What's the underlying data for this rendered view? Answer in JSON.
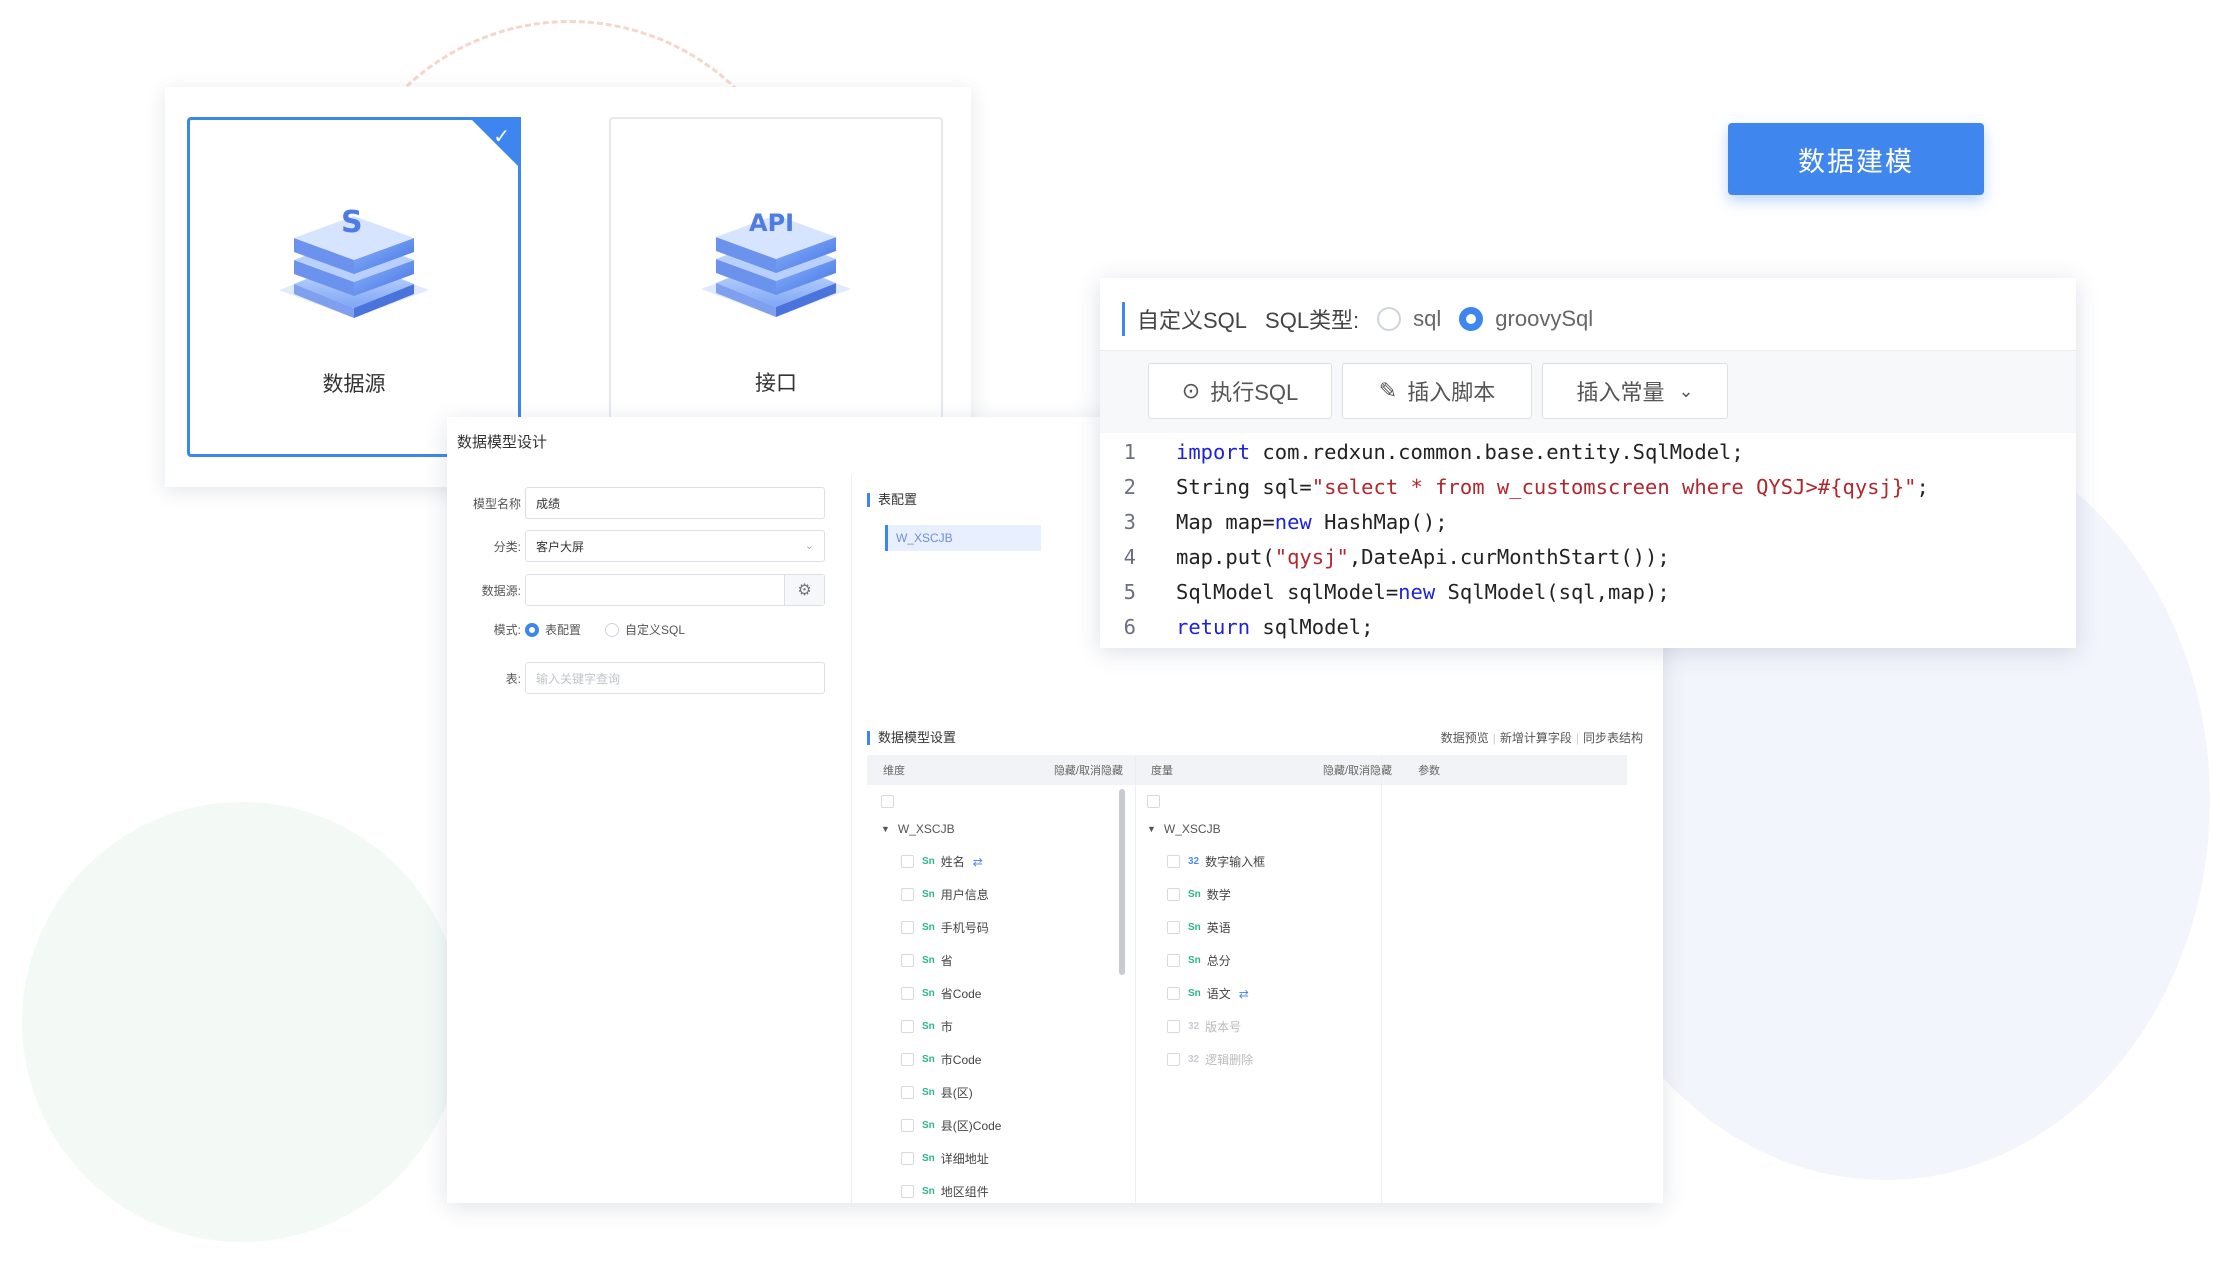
{
  "source_cards": [
    {
      "label": "数据源",
      "selected": true,
      "icon": "database-sql-icon"
    },
    {
      "label": "接口",
      "selected": false,
      "icon": "database-api-icon"
    }
  ],
  "model_button": {
    "label": "数据建模"
  },
  "designer": {
    "title": "数据模型设计",
    "form": {
      "name_label": "模型名称",
      "name_value": "成绩",
      "category_label": "分类:",
      "category_value": "客户大屏",
      "source_label": "数据源:",
      "source_value": "",
      "mode_label": "模式:",
      "mode_options": [
        "表配置",
        "自定义SQL"
      ],
      "table_label": "表:",
      "table_placeholder": "输入关键字查询"
    },
    "table_config": {
      "title": "表配置",
      "selected_table": "W_XSCJB"
    },
    "settings": {
      "title": "数据模型设置",
      "links": [
        "数据预览",
        "新增计算字段",
        "同步表结构"
      ],
      "dim_header": "维度",
      "dim_hide": "隐藏/取消隐藏",
      "measure_header": "度量",
      "measure_hide": "隐藏/取消隐藏",
      "param_header": "参数",
      "dim_root": "W_XSCJB",
      "dim_fields": [
        "姓名",
        "用户信息",
        "手机号码",
        "省",
        "省Code",
        "市",
        "市Code",
        "县(区)",
        "县(区)Code",
        "详细地址",
        "地区组件"
      ],
      "measure_root": "W_XSCJB",
      "measure_fields": [
        "数字输入框",
        "数学",
        "英语",
        "总分",
        "语文",
        "版本号",
        "逻辑删除"
      ]
    }
  },
  "sql_editor": {
    "title": "自定义SQL",
    "type_label": "SQL类型:",
    "type_options": [
      "sql",
      "groovySql"
    ],
    "selected_type": "groovySql",
    "toolbar": {
      "run": "执行SQL",
      "insert_script": "插入脚本",
      "insert_const": "插入常量"
    },
    "lines": [
      {
        "n": "1",
        "parts": [
          {
            "k": "kw",
            "t": "import"
          },
          {
            "k": "tx",
            "t": " com.redxun.common.base.entity.SqlModel;"
          }
        ]
      },
      {
        "n": "2",
        "parts": [
          {
            "k": "tx",
            "t": "String sql="
          },
          {
            "k": "str",
            "t": "\"select * from w_customscreen where QYSJ>#{qysj}\""
          },
          {
            "k": "tx",
            "t": ";"
          }
        ]
      },
      {
        "n": "3",
        "parts": [
          {
            "k": "tx",
            "t": "Map map="
          },
          {
            "k": "kw",
            "t": "new"
          },
          {
            "k": "tx",
            "t": " HashMap();"
          }
        ]
      },
      {
        "n": "4",
        "parts": [
          {
            "k": "tx",
            "t": "map.put("
          },
          {
            "k": "str",
            "t": "\"qysj\""
          },
          {
            "k": "tx",
            "t": ",DateApi.curMonthStart());"
          }
        ]
      },
      {
        "n": "5",
        "parts": [
          {
            "k": "tx",
            "t": "SqlModel sqlModel="
          },
          {
            "k": "kw",
            "t": "new"
          },
          {
            "k": "tx",
            "t": " SqlModel(sql,map);"
          }
        ]
      },
      {
        "n": "6",
        "parts": [
          {
            "k": "kw",
            "t": "return"
          },
          {
            "k": "tx",
            "t": " sqlModel;"
          }
        ]
      }
    ]
  },
  "colors": {
    "accent": "#3d86f0",
    "button": "#3f86ee",
    "keyword": "#1d23d6",
    "string": "#b3262c"
  }
}
